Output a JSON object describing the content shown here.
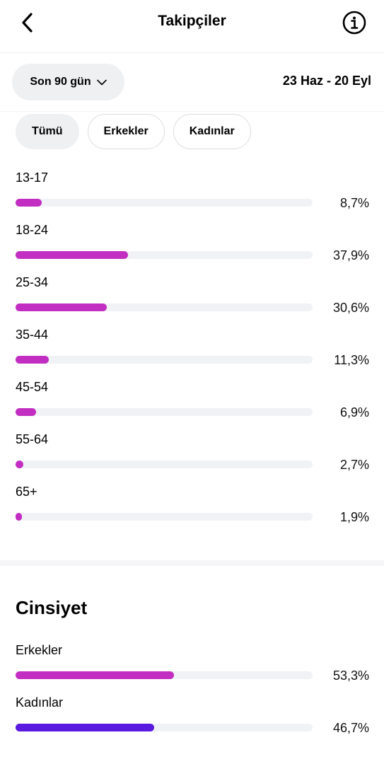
{
  "header": {
    "title": "Takipçiler"
  },
  "filter": {
    "range_label": "Son 90 gün",
    "date_range": "23 Haz - 20 Eyl"
  },
  "tabs": [
    {
      "label": "Tümü",
      "active": true
    },
    {
      "label": "Erkekler",
      "active": false
    },
    {
      "label": "Kadınlar",
      "active": false
    }
  ],
  "age": [
    {
      "label": "13-17",
      "value": "8,7%",
      "fraction": 0.087
    },
    {
      "label": "18-24",
      "value": "37,9%",
      "fraction": 0.379
    },
    {
      "label": "25-34",
      "value": "30,6%",
      "fraction": 0.306
    },
    {
      "label": "35-44",
      "value": "11,3%",
      "fraction": 0.113
    },
    {
      "label": "45-54",
      "value": "6,9%",
      "fraction": 0.069
    },
    {
      "label": "55-64",
      "value": "2,7%",
      "fraction": 0.027
    },
    {
      "label": "65+",
      "value": "1,9%",
      "fraction": 0.019
    }
  ],
  "gender": {
    "title": "Cinsiyet",
    "items": [
      {
        "label": "Erkekler",
        "value": "53,3%",
        "fraction": 0.533
      },
      {
        "label": "Kadınlar",
        "value": "46,7%",
        "fraction": 0.467
      }
    ]
  },
  "colors": {
    "age_bar": "#c22dc2",
    "men_bar": "#c22dc2",
    "women_bar": "#5a1ae0",
    "track": "#f1f2f5"
  },
  "icons": {
    "back": "chevron-left-icon",
    "info": "info-icon",
    "dropdown": "chevron-down-icon"
  }
}
